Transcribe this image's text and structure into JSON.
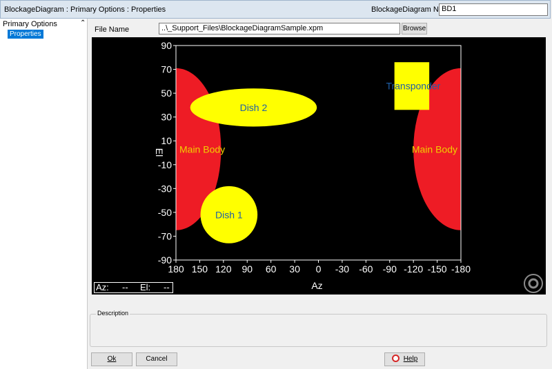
{
  "window": {
    "title": "BlockageDiagram : Primary Options : Properties",
    "name_label": "BlockageDiagram Name",
    "name_value": "BD1"
  },
  "sidebar": {
    "group_label": "Primary Options",
    "items": [
      {
        "label": "Properties",
        "selected": true
      }
    ]
  },
  "file": {
    "label": "File Name",
    "value": "..\\_Support_Files\\BlockageDiagramSample.xpm",
    "browse_label": "Browse"
  },
  "chart_data": {
    "type": "blockage-diagram",
    "xlabel": "Az",
    "ylabel": "El",
    "xlim": [
      180,
      -180
    ],
    "ylim": [
      -90,
      90
    ],
    "x_ticks": [
      180,
      150,
      120,
      90,
      60,
      30,
      0,
      -30,
      -60,
      -90,
      -120,
      -150,
      -180
    ],
    "y_ticks": [
      90,
      70,
      50,
      30,
      10,
      -10,
      -30,
      -50,
      -70,
      -90
    ],
    "regions": [
      {
        "label": "Main Body",
        "shape": "ellipse",
        "az_center": 180,
        "el_center": 3,
        "az_radius": 57,
        "el_radius": 68,
        "fill": "#ee1c25",
        "text_color": "#f0d000"
      },
      {
        "label": "Main Body",
        "shape": "ellipse",
        "az_center": -180,
        "el_center": 3,
        "az_radius": 60,
        "el_radius": 68,
        "fill": "#ee1c25",
        "text_color": "#f0d000"
      },
      {
        "label": "Dish 2",
        "shape": "ellipse",
        "az_center": 82,
        "el_center": 38,
        "az_radius": 80,
        "el_radius": 16,
        "fill": "#ffff00",
        "text_color": "#1f5fa8"
      },
      {
        "label": "Dish 1",
        "shape": "ellipse",
        "az_center": 113,
        "el_center": -52,
        "az_radius": 36,
        "el_radius": 24,
        "fill": "#ffff00",
        "text_color": "#1f5fa8"
      },
      {
        "label": "Transponder",
        "shape": "rect",
        "az_min": -140,
        "az_max": -96,
        "el_min": 36,
        "el_max": 76,
        "fill": "#ffff00",
        "text_color": "#1f5fa8"
      }
    ],
    "background": "#000000",
    "axis_color": "#ffffff"
  },
  "readout": {
    "az_label": "Az:",
    "az_value": "--",
    "el_label": "El:",
    "el_value": "--"
  },
  "description": {
    "label": "Description",
    "value": ""
  },
  "buttons": {
    "ok": "Ok",
    "cancel": "Cancel",
    "help": "Help"
  }
}
